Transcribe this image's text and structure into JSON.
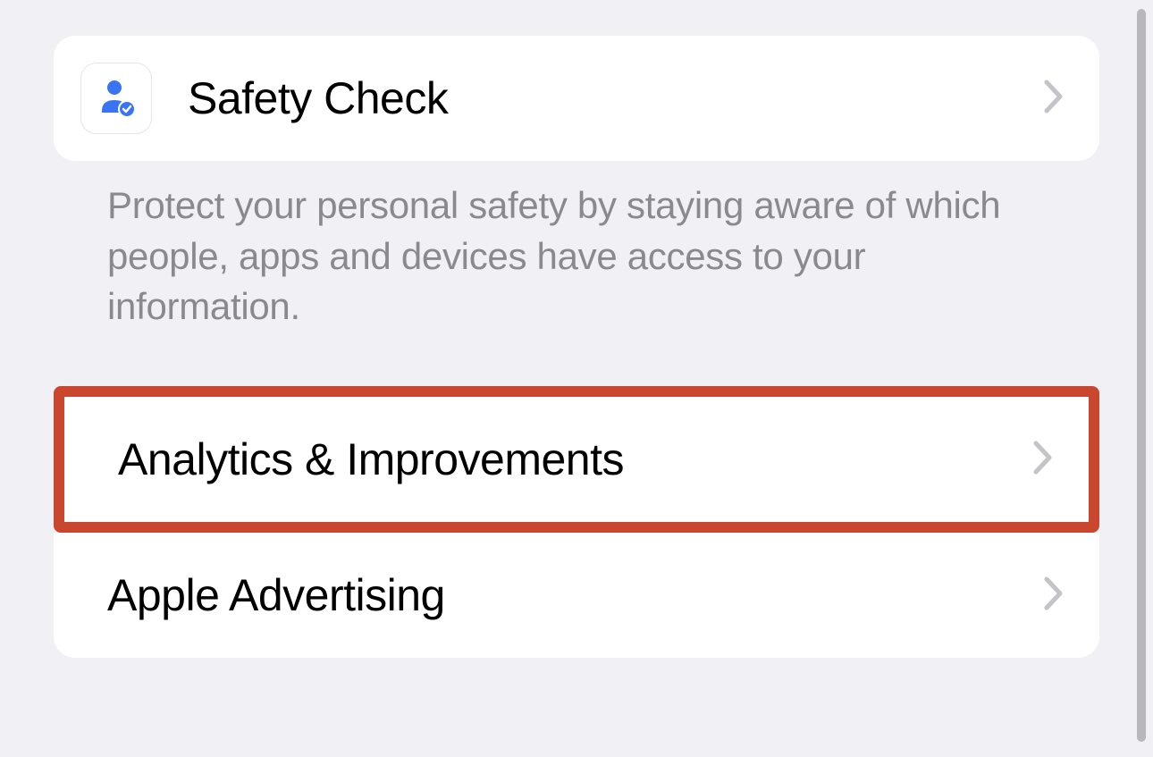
{
  "section1": {
    "safetyCheck": {
      "label": "Safety Check",
      "footer": "Protect your personal safety by staying aware of which people, apps and devices have access to your information."
    }
  },
  "section2": {
    "analytics": {
      "label": "Analytics & Improvements"
    },
    "advertising": {
      "label": "Apple Advertising"
    }
  },
  "colors": {
    "highlight": "#c9472f",
    "iconBlue": "#3b74f2"
  }
}
